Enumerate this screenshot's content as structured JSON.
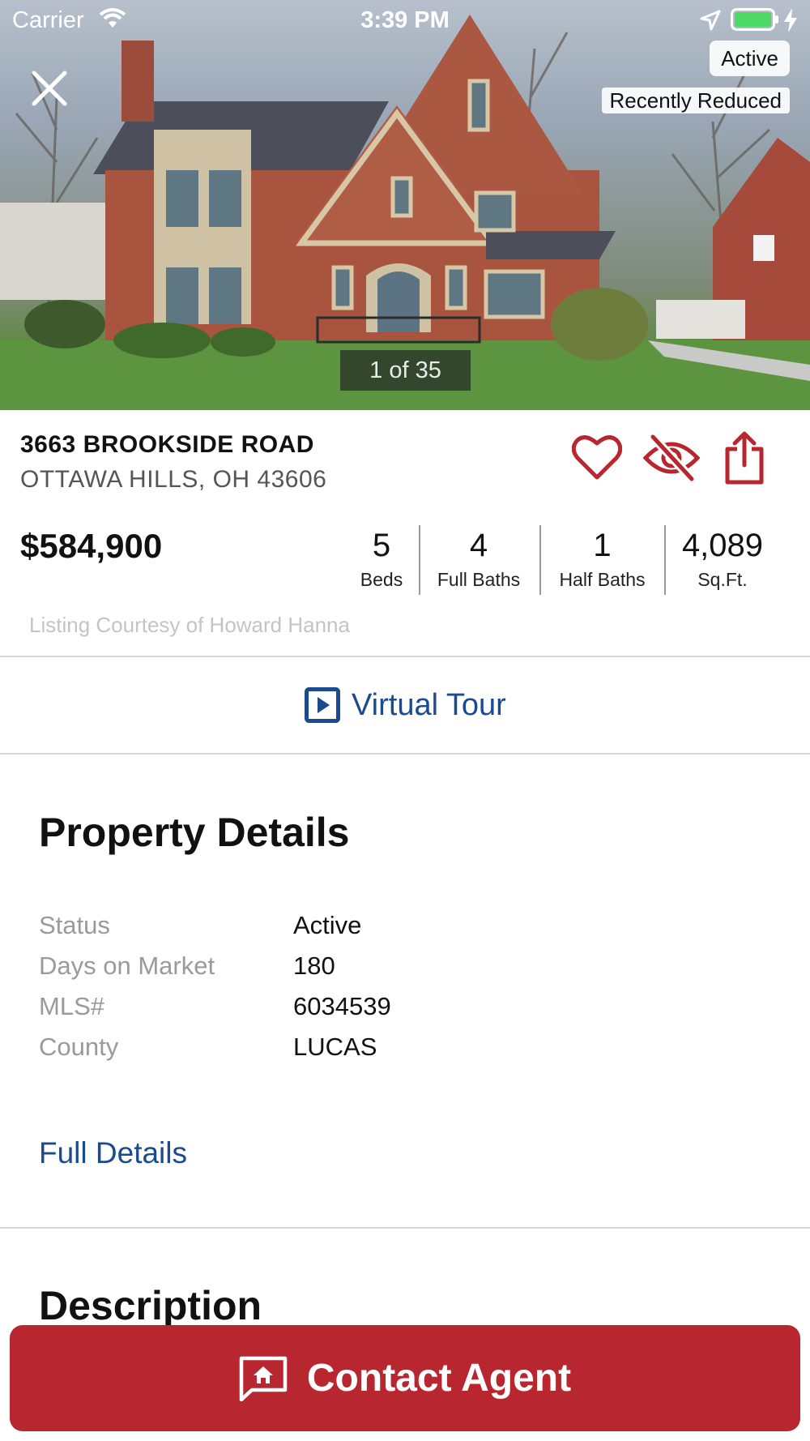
{
  "status_bar": {
    "carrier": "Carrier",
    "time": "3:39 PM"
  },
  "photo": {
    "status_badge": "Active",
    "reduced_badge": "Recently Reduced",
    "counter": "1 of 35"
  },
  "listing": {
    "address_line1": "3663 BROOKSIDE ROAD",
    "address_line2": "OTTAWA HILLS, OH 43606",
    "price": "$584,900",
    "stats": [
      {
        "value": "5",
        "label": "Beds"
      },
      {
        "value": "4",
        "label": "Full Baths"
      },
      {
        "value": "1",
        "label": "Half Baths"
      },
      {
        "value": "4,089",
        "label": "Sq.Ft."
      }
    ],
    "courtesy": "Listing Courtesy of Howard Hanna"
  },
  "actions": {
    "favorite_icon": "heart-icon",
    "hide_icon": "eye-slash-icon",
    "share_icon": "share-icon"
  },
  "virtual_tour": {
    "label": "Virtual Tour"
  },
  "property_details": {
    "title": "Property Details",
    "rows": [
      {
        "key": "Status",
        "value": "Active"
      },
      {
        "key": "Days on Market",
        "value": "180"
      },
      {
        "key": "MLS#",
        "value": "6034539"
      },
      {
        "key": "County",
        "value": "LUCAS"
      }
    ],
    "full_details_link": "Full Details"
  },
  "description": {
    "title": "Description"
  },
  "contact": {
    "label": "Contact Agent"
  },
  "colors": {
    "brand_red": "#b8262f",
    "link_blue": "#1b4b8f"
  }
}
